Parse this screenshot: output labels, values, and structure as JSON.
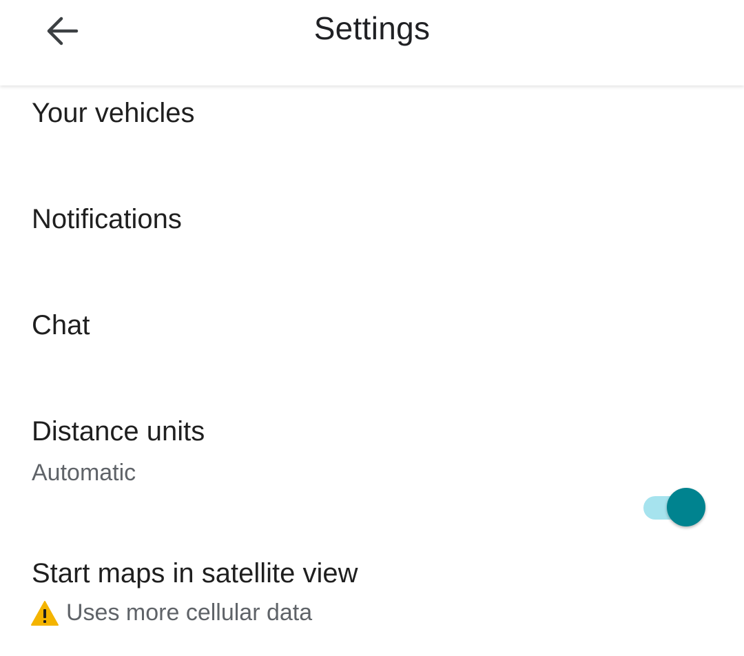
{
  "header": {
    "title": "Settings",
    "back_icon": "arrow-back-icon"
  },
  "settings": {
    "items": [
      {
        "title": "Your vehicles"
      },
      {
        "title": "Notifications"
      },
      {
        "title": "Chat"
      },
      {
        "title": "Distance units",
        "subtitle": "Automatic"
      },
      {
        "title": "Start maps in satellite view",
        "warning": "Uses more cellular data",
        "warning_icon": "warning-icon",
        "toggle_on": true
      }
    ]
  },
  "colors": {
    "toggle_thumb": "#00838f",
    "toggle_track": "#a6e3ee",
    "warning": "#f4b400"
  }
}
